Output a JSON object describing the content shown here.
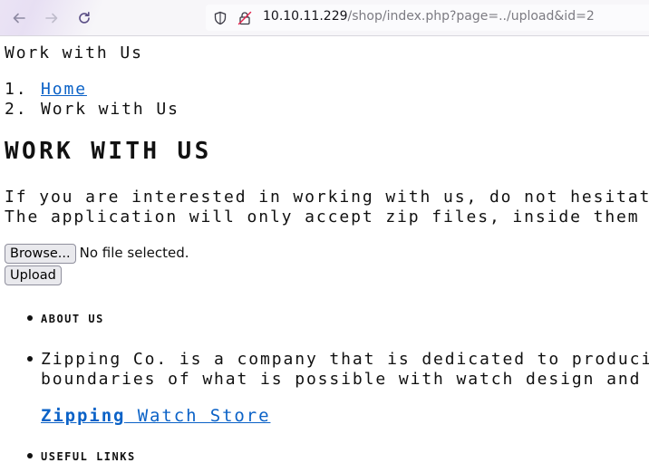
{
  "browser": {
    "url_host": "10.10.11.229",
    "url_path": "/shop/index.php?page=../upload&id=2"
  },
  "page": {
    "document_title": "Work with Us",
    "breadcrumb": [
      {
        "num": "1.",
        "label": "Home",
        "link": true
      },
      {
        "num": "2.",
        "label": "Work with Us",
        "link": false
      }
    ],
    "heading": "WORK WITH US",
    "paragraph_lines": [
      "If you are interested in working with us, do not hesitate",
      "The application will only accept zip files, inside them t"
    ],
    "file_input": {
      "button_label": "Browse...",
      "status": "No file selected."
    },
    "upload_button": "Upload",
    "about_heading": "ABOUT US",
    "about_lines": [
      "Zipping Co. is a company that is dedicated to producin",
      "boundaries of what is possible with watch design and a"
    ],
    "store_link": {
      "bold": "Zipping",
      "rest": " Watch Store"
    },
    "useful_links_heading": "USEFUL LINKS"
  }
}
